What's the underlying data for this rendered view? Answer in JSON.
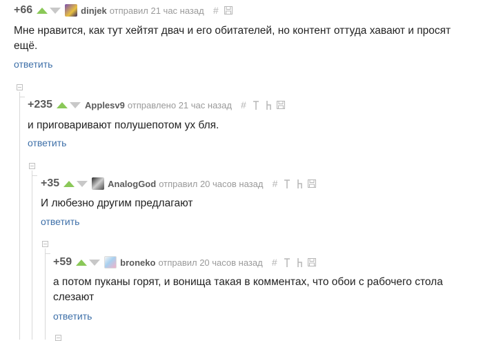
{
  "colors": {
    "vote_up": "#8ac858",
    "vote_down": "#c8c8c8",
    "link": "#3d6fa8",
    "meta": "#999999"
  },
  "comments": [
    {
      "rating": "+66",
      "author": "dinjek",
      "meta": "отправил 21 час назад",
      "text": "Мне нравится, как тут хейтят двач и его обитателей, но контент оттуда хавают и просят ещё.",
      "reply_label": "ответить",
      "avatar_icon": "avatar-dinjek"
    },
    {
      "rating": "+235",
      "author": "Applesv9",
      "meta": "отправлено 21 час назад",
      "text": "и приговаривают полушепотом ух бля.",
      "reply_label": "ответить"
    },
    {
      "rating": "+35",
      "author": "AnalogGod",
      "meta": "отправил 20 часов назад",
      "text": "И любезно другим предлагают",
      "reply_label": "ответить",
      "avatar_icon": "avatar-analoggod"
    },
    {
      "rating": "+59",
      "author": "broneko",
      "meta": "отправил 20 часов назад",
      "text": "а потом пуканы горят, и вонища такая в комментах, что обои с рабочего стола слезают",
      "reply_label": "ответить",
      "avatar_icon": "avatar-broneko"
    }
  ],
  "icons": {
    "hash": "#",
    "save": "save-icon",
    "up": "branch-up-icon",
    "parent": "parent-icon"
  }
}
